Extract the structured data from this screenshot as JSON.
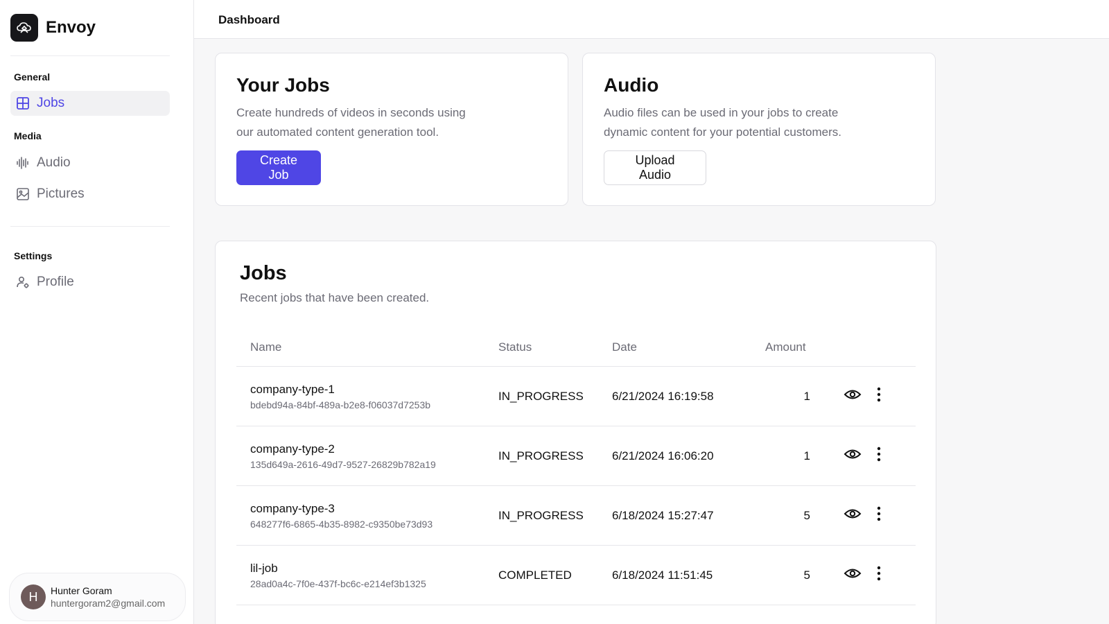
{
  "brand": {
    "name": "Envoy"
  },
  "sidebar": {
    "sections": [
      {
        "label": "General",
        "items": [
          {
            "label": "Jobs",
            "icon": "grid-icon",
            "active": true
          }
        ]
      },
      {
        "label": "Media",
        "items": [
          {
            "label": "Audio",
            "icon": "audio-wave-icon"
          },
          {
            "label": "Pictures",
            "icon": "image-icon"
          }
        ]
      },
      {
        "label": "Settings",
        "items": [
          {
            "label": "Profile",
            "icon": "user-gear-icon"
          }
        ]
      }
    ]
  },
  "user": {
    "initial": "H",
    "name": "Hunter Goram",
    "email": "huntergoram2@gmail.com"
  },
  "header": {
    "title": "Dashboard"
  },
  "cards": {
    "jobs": {
      "title": "Your Jobs",
      "description": "Create hundreds of videos in seconds using our automated content generation tool.",
      "button": "Create Job"
    },
    "audio": {
      "title": "Audio",
      "description": "Audio files can be used in your jobs to create dynamic content for your potential customers.",
      "button": "Upload Audio"
    }
  },
  "jobs_table": {
    "title": "Jobs",
    "subtitle": "Recent jobs that have been created.",
    "columns": [
      "Name",
      "Status",
      "Date",
      "Amount"
    ],
    "rows": [
      {
        "name": "company-type-1",
        "id": "bdebd94a-84bf-489a-b2e8-f06037d7253b",
        "status": "IN_PROGRESS",
        "date": "6/21/2024 16:19:58",
        "amount": "1"
      },
      {
        "name": "company-type-2",
        "id": "135d649a-2616-49d7-9527-26829b782a19",
        "status": "IN_PROGRESS",
        "date": "6/21/2024 16:06:20",
        "amount": "1"
      },
      {
        "name": "company-type-3",
        "id": "648277f6-6865-4b35-8982-c9350be73d93",
        "status": "IN_PROGRESS",
        "date": "6/18/2024 15:27:47",
        "amount": "5"
      },
      {
        "name": "lil-job",
        "id": "28ad0a4c-7f0e-437f-bc6c-e214ef3b1325",
        "status": "COMPLETED",
        "date": "6/18/2024 11:51:45",
        "amount": "5"
      }
    ]
  },
  "colors": {
    "accent": "#4f46e5",
    "text": "#111111",
    "muted": "#6b6b75",
    "border": "#e6e6ea"
  }
}
